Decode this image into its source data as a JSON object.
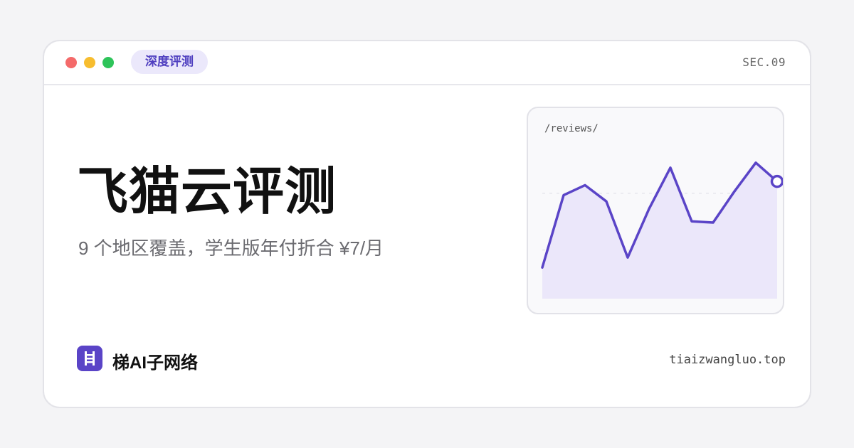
{
  "header": {
    "tag": "深度评测",
    "section": "SEC.09"
  },
  "main": {
    "title": "飞猫云评测",
    "subtitle": "9 个地区覆盖，学生版年付折合 ¥7/月"
  },
  "chart_panel": {
    "path_label": "/reviews/"
  },
  "chart_data": {
    "type": "area",
    "x": [
      0,
      1,
      2,
      3,
      4,
      5,
      6,
      7,
      8,
      9,
      10,
      11
    ],
    "values": [
      25,
      83,
      91,
      78,
      33,
      72,
      105,
      62,
      61,
      86,
      109,
      94
    ],
    "ylim": [
      0,
      130
    ],
    "grid": true,
    "title": "",
    "xlabel": "",
    "ylabel": "",
    "colors": {
      "line": "#5a44c7",
      "fill": "#ebe7fa"
    }
  },
  "footer": {
    "brand_name": "梯AI子网络",
    "domain": "tiaizwangluo.top"
  },
  "colors": {
    "accent": "#5a44c7",
    "tag_bg": "#ebe8fb"
  }
}
